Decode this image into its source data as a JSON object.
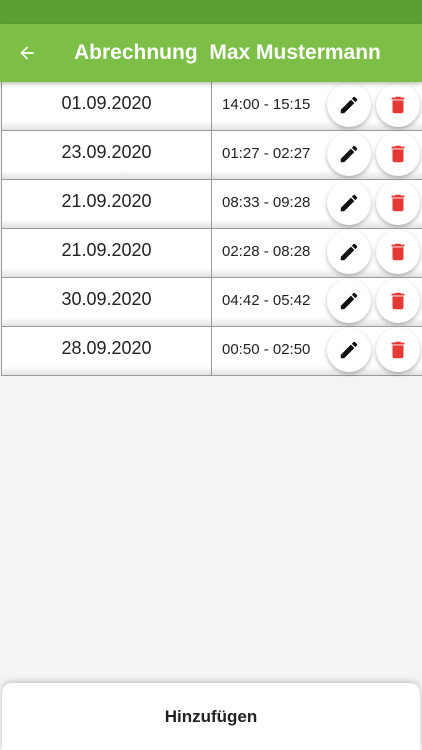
{
  "app_bar": {
    "title": "Abrechnung  Max Mustermann",
    "back_icon": "arrow-left-icon",
    "color": "#7dbe46",
    "status_bar_color": "#5c9e32"
  },
  "entries": [
    {
      "date": "01.09.2020",
      "time": "14:00 - 15:15"
    },
    {
      "date": "23.09.2020",
      "time": "01:27 - 02:27"
    },
    {
      "date": "21.09.2020",
      "time": "08:33 - 09:28"
    },
    {
      "date": "21.09.2020",
      "time": "02:28 - 08:28"
    },
    {
      "date": "30.09.2020",
      "time": "04:42 - 05:42"
    },
    {
      "date": "28.09.2020",
      "time": "00:50 - 02:50"
    }
  ],
  "row_actions": {
    "edit_icon": "pencil-icon",
    "delete_icon": "trash-icon",
    "delete_color": "#e53935"
  },
  "footer": {
    "add_label": "Hinzufügen"
  }
}
